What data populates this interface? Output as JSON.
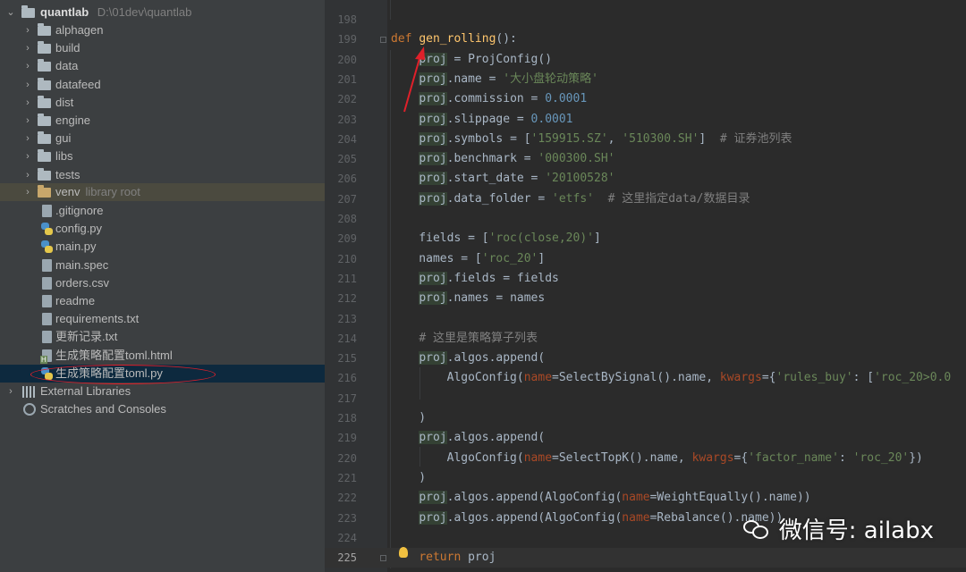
{
  "project": {
    "root_name": "quantlab",
    "root_path": "D:\\01dev\\quantlab",
    "folders": [
      "alphagen",
      "build",
      "data",
      "datafeed",
      "dist",
      "engine",
      "gui",
      "libs",
      "tests"
    ],
    "venv_name": "venv",
    "venv_hint": "library root",
    "files": [
      ".gitignore",
      "config.py",
      "main.py",
      "main.spec",
      "orders.csv",
      "readme",
      "requirements.txt",
      "更新记录.txt",
      "生成策略配置toml.html",
      "生成策略配置toml.py"
    ],
    "external_libraries": "External Libraries",
    "scratches": "Scratches and Consoles"
  },
  "editor": {
    "line_numbers": [
      "198",
      "199",
      "200",
      "201",
      "202",
      "203",
      "204",
      "205",
      "206",
      "207",
      "208",
      "209",
      "210",
      "211",
      "212",
      "213",
      "214",
      "215",
      "216",
      "217",
      "218",
      "219",
      "220",
      "221",
      "222",
      "223",
      "224",
      "225"
    ],
    "current_line": "225"
  },
  "code": {
    "l199_def": "def",
    "l199_name": "gen_rolling",
    "l199_rest": "():",
    "l200": [
      "proj",
      " = ProjConfig()"
    ],
    "l201": [
      "proj",
      ".name = ",
      "'大小盘轮动策略'"
    ],
    "l202": [
      "proj",
      ".commission = ",
      "0.0001"
    ],
    "l203": [
      "proj",
      ".slippage = ",
      "0.0001"
    ],
    "l204": [
      "proj",
      ".symbols = [",
      "'159915.SZ'",
      ", ",
      "'510300.SH'",
      "]  ",
      "# 证券池列表"
    ],
    "l205": [
      "proj",
      ".benchmark = ",
      "'000300.SH'"
    ],
    "l206": [
      "proj",
      ".start_date = ",
      "'20100528'"
    ],
    "l207": [
      "proj",
      ".data_folder = ",
      "'etfs'",
      "  ",
      "# 这里指定data/数据目录"
    ],
    "l209": [
      "fields = [",
      "'roc(close,20)'",
      "]"
    ],
    "l210": [
      "names = [",
      "'roc_20'",
      "]"
    ],
    "l211": [
      "proj",
      ".fields = fields"
    ],
    "l212": [
      "proj",
      ".names = names"
    ],
    "l214": "# 这里是策略算子列表",
    "l215": [
      "proj",
      ".algos.append("
    ],
    "l216": [
      "AlgoConfig(",
      "name",
      "=SelectBySignal().name, ",
      "kwargs",
      "={",
      "'rules_buy'",
      ": [",
      "'roc_20>0.0"
    ],
    "l218": ")",
    "l219": [
      "proj",
      ".algos.append("
    ],
    "l220": [
      "AlgoConfig(",
      "name",
      "=SelectTopK().name, ",
      "kwargs",
      "={",
      "'factor_name'",
      ": ",
      "'roc_20'",
      "})"
    ],
    "l221": ")",
    "l222": [
      "proj",
      ".algos.append(AlgoConfig(",
      "name",
      "=WeightEqually().name))"
    ],
    "l223": [
      "proj",
      ".algos.append(AlgoConfig(",
      "name",
      "=Rebalance().name))"
    ],
    "l225": [
      "return",
      " proj"
    ]
  },
  "watermark": "微信号: ailabx",
  "colors": {
    "panel_bg": "#3c3f41",
    "editor_bg": "#2b2b2b",
    "keyword": "#cc7832",
    "function": "#ffc66d",
    "string": "#6a8759",
    "number": "#6897bb",
    "comment": "#808080",
    "annotation": "#e0202a"
  }
}
